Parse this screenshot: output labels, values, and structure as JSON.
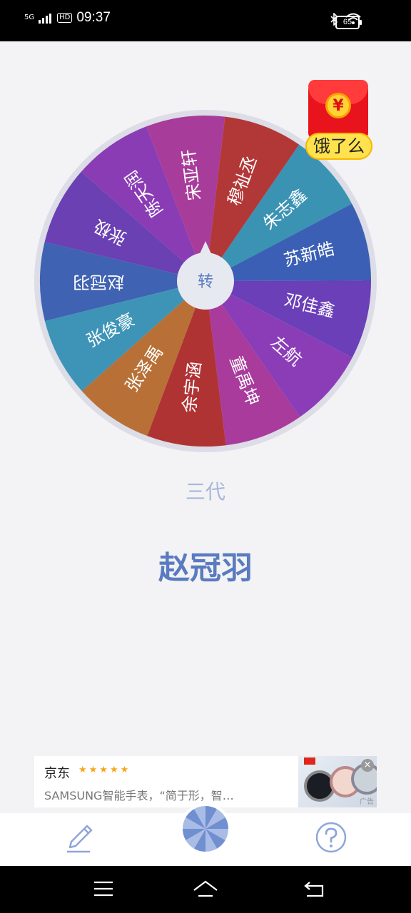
{
  "status": {
    "network": "5G",
    "hd": "HD",
    "time": "09:37",
    "battery": "65"
  },
  "wheel": {
    "center_label": "转",
    "segments": [
      {
        "name": "赵冠羽",
        "color": "#3f62b3"
      },
      {
        "name": "张极",
        "color": "#6b40b3"
      },
      {
        "name": "陈天润",
        "color": "#8a3cb5"
      },
      {
        "name": "宋亚轩",
        "color": "#a83c9a"
      },
      {
        "name": "穆祉丞",
        "color": "#b23838"
      },
      {
        "name": "朱志鑫",
        "color": "#3a93b3"
      },
      {
        "name": "苏新皓",
        "color": "#3b5fb5"
      },
      {
        "name": "邓佳鑫",
        "color": "#6a3fb8"
      },
      {
        "name": "左航",
        "color": "#8b3db8"
      },
      {
        "name": "童禹坤",
        "color": "#a83b9c"
      },
      {
        "name": "余宇涵",
        "color": "#b03334"
      },
      {
        "name": "张泽禹",
        "color": "#b87036"
      },
      {
        "name": "张俊豪",
        "color": "#3d94b7"
      }
    ]
  },
  "redpacket": {
    "label": "饿了么",
    "coin": "¥"
  },
  "result": {
    "category": "三代",
    "picked": "赵冠羽"
  },
  "ad": {
    "brand": "京东",
    "stars": "★★★★★",
    "description": "SAMSUNG智能手表，“简于形，智…",
    "tag": "广告",
    "close": "×"
  },
  "tabbar": {
    "edit_icon": "pencil-icon",
    "spin_icon": "mini-wheel-icon",
    "help_icon": "question-icon"
  },
  "navbar": {
    "menu_icon": "menu-icon",
    "home_icon": "home-icon",
    "back_icon": "back-icon"
  }
}
